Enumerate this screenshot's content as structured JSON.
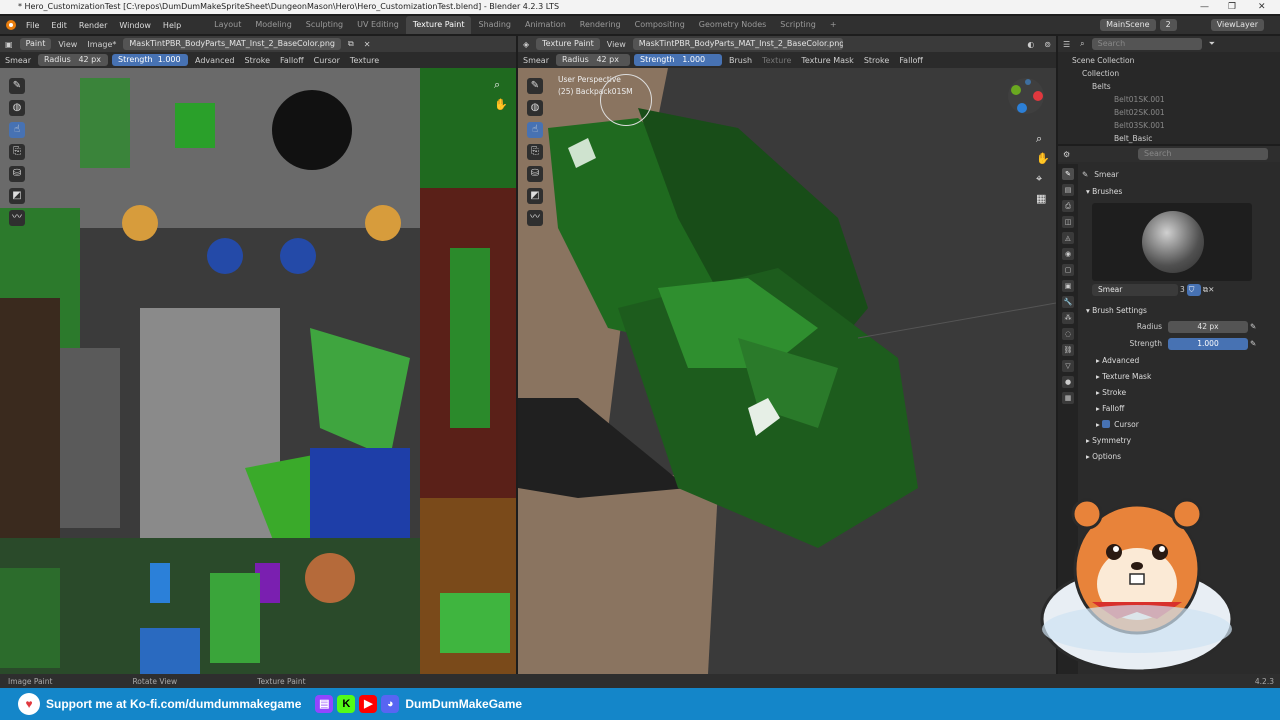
{
  "titlebar": {
    "text": "* Hero_CustomizationTest [C:\\repos\\DumDumMakeSpriteSheet\\DungeonMason\\Hero\\Hero_CustomizationTest.blend] - Blender 4.2.3 LTS",
    "min": "—",
    "max": "❐",
    "close": "✕"
  },
  "topbar": {
    "menus": [
      "File",
      "Edit",
      "Render",
      "Window",
      "Help"
    ],
    "workspaces": [
      "Layout",
      "Modeling",
      "Sculpting",
      "UV Editing",
      "Texture Paint",
      "Shading",
      "Animation",
      "Rendering",
      "Compositing",
      "Geometry Nodes",
      "Scripting"
    ],
    "active_workspace": "Texture Paint",
    "add": "+",
    "scene": "MainScene",
    "scene_count": "2",
    "view_layer": "ViewLayer"
  },
  "image_editor": {
    "mode": "Paint",
    "view": "View",
    "image_menu": "Image*",
    "image_name": "MaskTintPBR_BodyParts_MAT_Inst_2_BaseColor.png",
    "brush": "Smear",
    "radius_label": "Radius",
    "radius_value": "42 px",
    "strength_label": "Strength",
    "strength_value": "1.000",
    "advanced": "Advanced",
    "stroke": "Stroke",
    "falloff": "Falloff",
    "cursor": "Cursor",
    "texture": "Texture"
  },
  "viewport": {
    "mode": "Texture Paint",
    "view": "View",
    "image_name": "MaskTintPBR_BodyParts_MAT_Inst_2_BaseColor.png",
    "brush": "Smear",
    "radius_label": "Radius",
    "radius_value": "42 px",
    "strength_label": "Strength",
    "strength_value": "1.000",
    "brush_menu": "Brush",
    "texture": "Texture",
    "texture_mask": "Texture Mask",
    "stroke": "Stroke",
    "falloff": "Falloff",
    "overlay_line1": "User Perspective",
    "overlay_line2": "(25) Backpack01SM"
  },
  "outliner": {
    "search_placeholder": "Search",
    "items": [
      {
        "label": "Scene Collection",
        "depth": 0
      },
      {
        "label": "Collection",
        "depth": 1
      },
      {
        "label": "Belts",
        "depth": 2
      },
      {
        "label": "Belt01SK.001",
        "depth": 3
      },
      {
        "label": "Belt02SK.001",
        "depth": 3
      },
      {
        "label": "Belt03SK.001",
        "depth": 3
      },
      {
        "label": "Belt_Basic",
        "depth": 3
      }
    ]
  },
  "properties": {
    "search_placeholder": "Search",
    "brush_name": "Smear",
    "brushes_panel": "Brushes",
    "brush_field": "Smear",
    "brush_users": "3",
    "brush_settings_panel": "Brush Settings",
    "radius_label": "Radius",
    "radius_value": "42 px",
    "strength_label": "Strength",
    "strength_value": "1.000",
    "subpanels": [
      "Advanced",
      "Texture Mask",
      "Stroke",
      "Falloff"
    ],
    "cursor_label": "Cursor",
    "cursor_checked": true,
    "symmetry": "Symmetry",
    "options": "Options"
  },
  "statusbar": {
    "items": [
      "Image Paint",
      "Rotate View",
      "Texture Paint"
    ],
    "version": "4.2.3"
  },
  "banner": {
    "kofi": "Support me at Ko-fi.com/dumdummakegame",
    "channel": "DumDumMakeGame"
  },
  "colors": {
    "accent": "#4772b3",
    "orange": "#e87d0d",
    "banner": "#1486c9"
  }
}
